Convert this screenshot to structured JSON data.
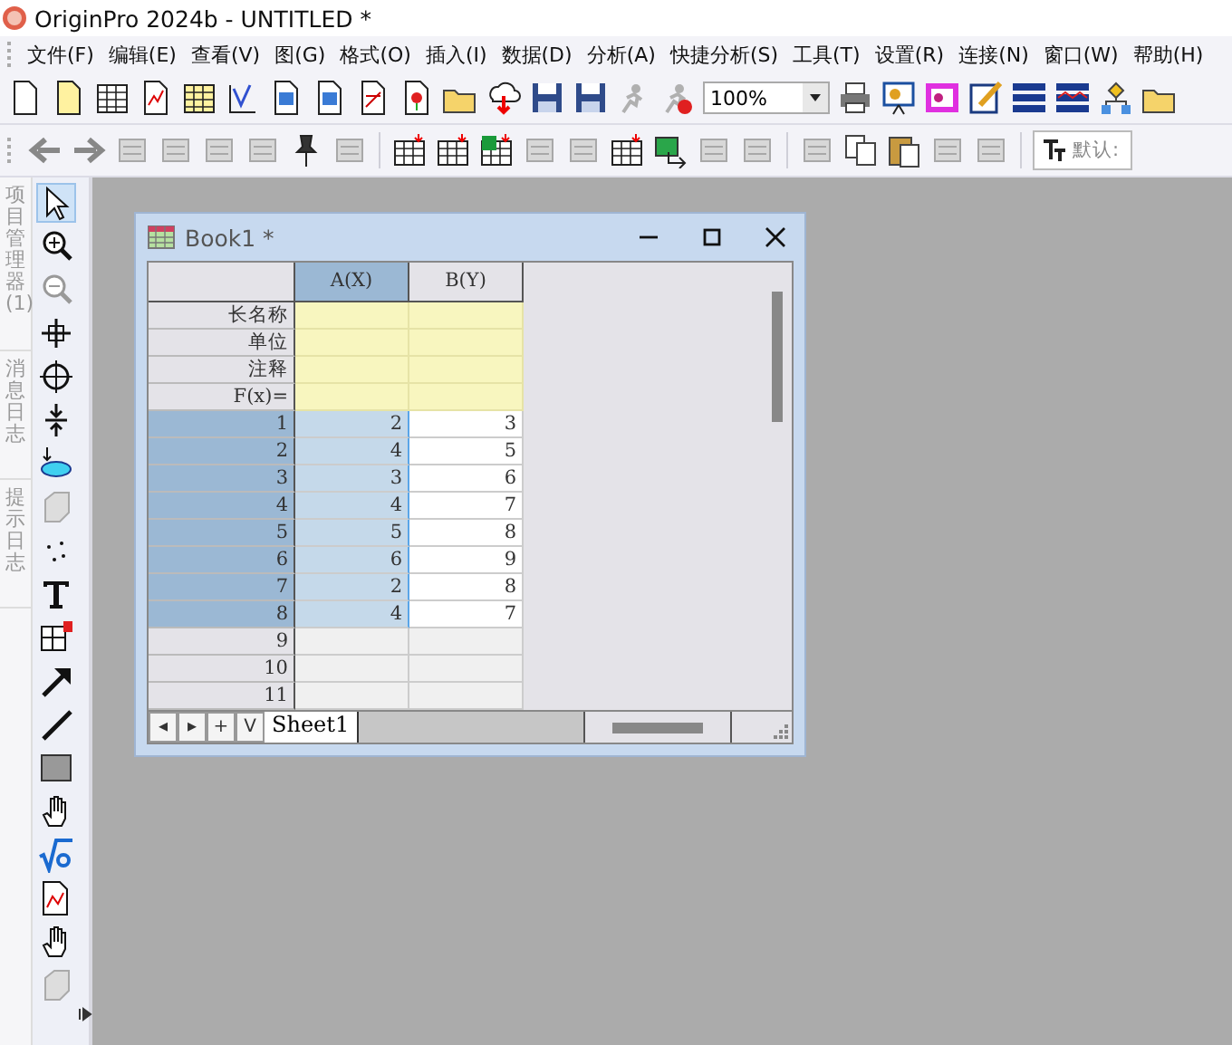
{
  "window": {
    "title": "OriginPro 2024b - UNTITLED *"
  },
  "menu": [
    "文件(F)",
    "编辑(E)",
    "查看(V)",
    "图(G)",
    "格式(O)",
    "插入(I)",
    "数据(D)",
    "分析(A)",
    "快捷分析(S)",
    "工具(T)",
    "设置(R)",
    "连接(N)",
    "窗口(W)",
    "帮助(H)"
  ],
  "toolbar": {
    "zoom": "100%",
    "font": "默认:"
  },
  "side_panels": [
    {
      "label": "项目管理器 (1)"
    },
    {
      "label": "消息日志"
    },
    {
      "label": "提示日志"
    }
  ],
  "workbook": {
    "title": "Book1 *",
    "columns": [
      {
        "label": "A(X)",
        "selected": true
      },
      {
        "label": "B(Y)",
        "selected": false
      }
    ],
    "header_rows": [
      "长名称",
      "单位",
      "注释",
      "F(x)="
    ],
    "rows": [
      {
        "index": "1",
        "values": [
          "2",
          "3"
        ],
        "selected": true
      },
      {
        "index": "2",
        "values": [
          "4",
          "5"
        ],
        "selected": true
      },
      {
        "index": "3",
        "values": [
          "3",
          "6"
        ],
        "selected": true
      },
      {
        "index": "4",
        "values": [
          "4",
          "7"
        ],
        "selected": true
      },
      {
        "index": "5",
        "values": [
          "5",
          "8"
        ],
        "selected": true
      },
      {
        "index": "6",
        "values": [
          "6",
          "9"
        ],
        "selected": true
      },
      {
        "index": "7",
        "values": [
          "2",
          "8"
        ],
        "selected": true
      },
      {
        "index": "8",
        "values": [
          "4",
          "7"
        ],
        "selected": true
      }
    ],
    "empty_rows": [
      "9",
      "10",
      "11"
    ],
    "sheet_nav": [
      "◂",
      "▸",
      "+",
      "V"
    ],
    "sheet_tabs": [
      {
        "label": "Sheet1",
        "selected": true
      }
    ]
  }
}
